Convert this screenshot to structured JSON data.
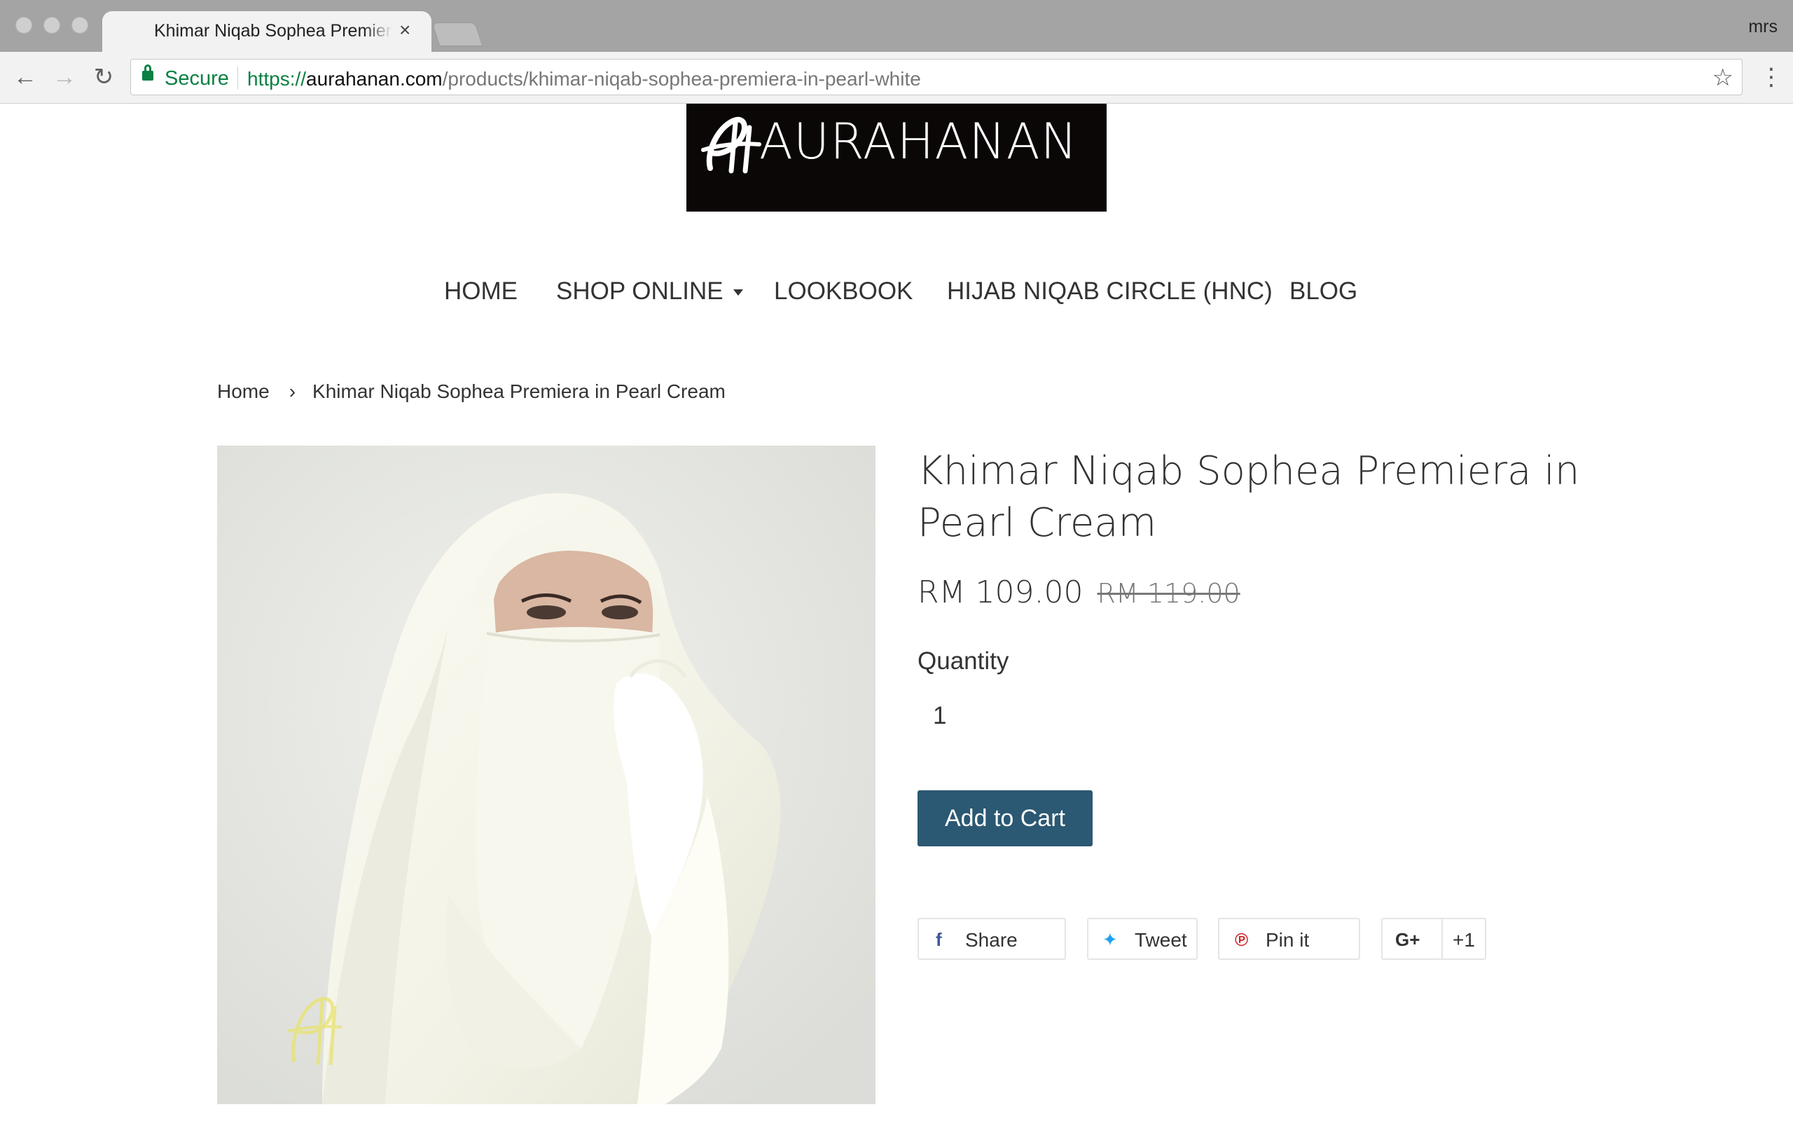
{
  "browser": {
    "tab_title": "Khimar Niqab Sophea Premiera in Pearl White",
    "profile": "mrs",
    "secure_label": "Secure",
    "url_scheme": "https://",
    "url_host": "aurahanan.com",
    "url_path": "/products/khimar-niqab-sophea-premiera-in-pearl-white"
  },
  "site": {
    "logo_text": "AURAHANAN",
    "logo_monogram": "AH"
  },
  "nav": {
    "items": [
      "HOME",
      "SHOP ONLINE",
      "LOOKBOOK",
      "HIJAB NIQAB CIRCLE (HNC)",
      "BLOG"
    ]
  },
  "breadcrumb": {
    "home": "Home",
    "separator": "›",
    "current": "Khimar Niqab Sophea Premiera in Pearl Cream"
  },
  "product": {
    "title": "Khimar Niqab Sophea Premiera in Pearl Cream",
    "price": "RM 109.00",
    "compare_price": "RM 119.00",
    "quantity_label": "Quantity",
    "quantity_value": "1",
    "add_to_cart": "Add to Cart",
    "image_watermark": "AURAHANAN"
  },
  "share": {
    "facebook": "Share",
    "twitter": "Tweet",
    "pinterest": "Pin it",
    "gplus_icon": "G+",
    "gplus": "+1"
  },
  "colors": {
    "accent_button": "#2b5872",
    "logo_bg": "#0b0707",
    "secure_green": "#0b8043",
    "facebook": "#3b5998",
    "twitter": "#1da1f2",
    "pinterest": "#cb2027"
  }
}
